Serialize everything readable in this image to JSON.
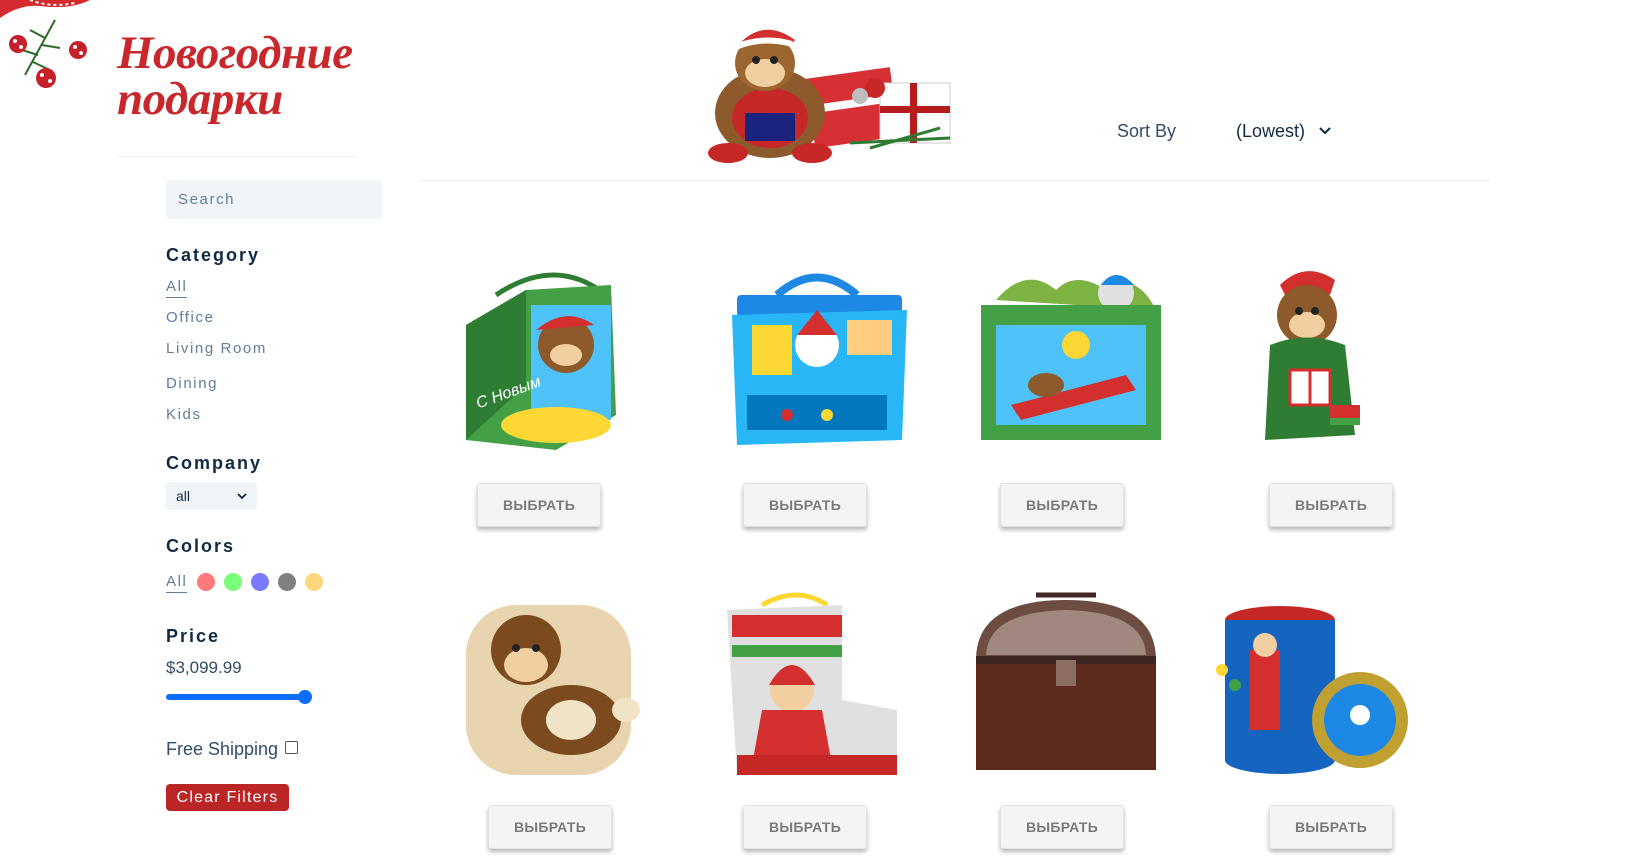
{
  "brand": {
    "title_line1": "Новогодние",
    "title_line2": "подарки"
  },
  "header": {
    "sort_label": "Sort By",
    "sort_value": "(Lowest)"
  },
  "filters": {
    "search_placeholder": "Search",
    "category_heading": "Category",
    "categories": [
      "All",
      "Office",
      "Living Room",
      "Dining",
      "Kids"
    ],
    "company_heading": "Company",
    "company_value": "all",
    "colors_heading": "Colors",
    "colors_all": "All",
    "colors": [
      "#ff7a7a",
      "#7aff7a",
      "#7a7aff",
      "#808080",
      "#ffd77a"
    ],
    "price_heading": "Price",
    "price_value": "$3,099.99",
    "price_level": 1.0,
    "free_shipping_label": "Free Shipping",
    "free_shipping_checked": false,
    "clear_label": "Clear Filters"
  },
  "products": [
    {
      "icon": "gift-bag-monkey-green-icon",
      "button": "ВЫБРАТЬ"
    },
    {
      "icon": "gift-case-santa-blue-icon",
      "button": "ВЫБРАТЬ"
    },
    {
      "icon": "gift-box-sleigh-green-icon",
      "button": "ВЫБРАТЬ"
    },
    {
      "icon": "gift-monkey-figure-icon",
      "button": "ВЫБРАТЬ"
    },
    {
      "icon": "plush-monkey-pillow-icon",
      "button": "ВЫБРАТЬ"
    },
    {
      "icon": "gift-tin-boot-icon",
      "button": "ВЫБРАТЬ"
    },
    {
      "icon": "wooden-chest-icon",
      "button": "ВЫБРАТЬ"
    },
    {
      "icon": "gift-tin-round-icon",
      "button": "ВЫБРАТЬ"
    }
  ]
}
